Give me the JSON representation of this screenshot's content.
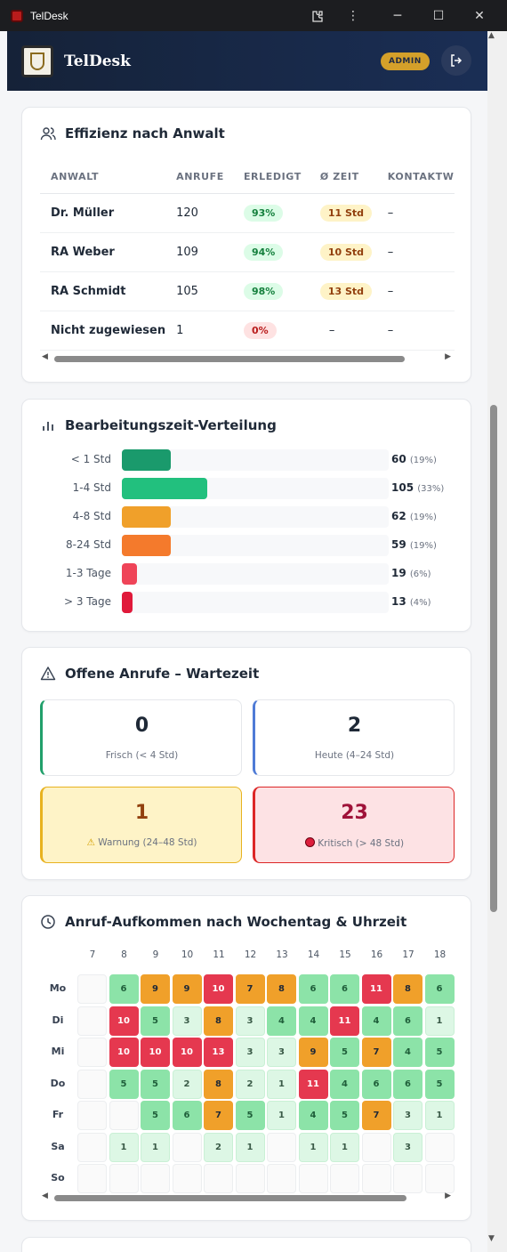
{
  "window": {
    "title": "TelDesk",
    "minimize": "─",
    "maximize": "☐",
    "close": "✕"
  },
  "header": {
    "brand": "TelDesk",
    "badge": "ADMIN"
  },
  "efficiency": {
    "title": "Effizienz nach Anwalt",
    "columns": [
      "ANWALT",
      "ANRUFE",
      "ERLEDIGT",
      "Ø ZEIT",
      "KONTAKTW"
    ],
    "rows": [
      {
        "name": "Dr. Müller",
        "calls": "120",
        "done": "93%",
        "done_status": "green",
        "time": "11 Std",
        "contact": "–"
      },
      {
        "name": "RA Weber",
        "calls": "109",
        "done": "94%",
        "done_status": "green",
        "time": "10 Std",
        "contact": "–"
      },
      {
        "name": "RA Schmidt",
        "calls": "105",
        "done": "98%",
        "done_status": "green",
        "time": "13 Std",
        "contact": "–"
      },
      {
        "name": "Nicht zugewiesen",
        "calls": "1",
        "done": "0%",
        "done_status": "red",
        "time": "–",
        "contact": "–"
      }
    ]
  },
  "distribution": {
    "title": "Bearbeitungszeit-Verteilung",
    "rows": [
      {
        "label": "< 1 Std",
        "value": "60",
        "pct": "(19%)",
        "fraction": 0.19,
        "color": "#1a9a6c"
      },
      {
        "label": "1-4 Std",
        "value": "105",
        "pct": "(33%)",
        "fraction": 0.33,
        "color": "#22c07e"
      },
      {
        "label": "4-8 Std",
        "value": "62",
        "pct": "(19%)",
        "fraction": 0.19,
        "color": "#f0a02a"
      },
      {
        "label": "8-24 Std",
        "value": "59",
        "pct": "(19%)",
        "fraction": 0.19,
        "color": "#f47a2c"
      },
      {
        "label": "1-3 Tage",
        "value": "19",
        "pct": "(6%)",
        "fraction": 0.06,
        "color": "#ef4458"
      },
      {
        "label": "> 3 Tage",
        "value": "13",
        "pct": "(4%)",
        "fraction": 0.04,
        "color": "#e0193a"
      }
    ]
  },
  "waiting": {
    "title": "Offene Anrufe – Wartezeit",
    "tiles": [
      {
        "value": "0",
        "label": "Frisch (< 4 Std)",
        "accent": "#21a06b",
        "bg": "#ffffff",
        "numcolor": "#1f2937"
      },
      {
        "value": "2",
        "label": "Heute (4–24 Std)",
        "accent": "#4f7bd6",
        "bg": "#ffffff",
        "numcolor": "#1f2937"
      },
      {
        "value": "1",
        "label": "Warnung (24–48 Std)",
        "icon": "warning-icon",
        "accent": "#e8b21f",
        "bg": "#fef3c7",
        "numcolor": "#92400e"
      },
      {
        "value": "23",
        "label": "Kritisch (> 48 Std)",
        "icon": "red-circle-icon",
        "accent": "#dc2626",
        "bg": "#fde2e4",
        "numcolor": "#9f1239"
      }
    ]
  },
  "heatmap": {
    "title": "Anruf-Aufkommen nach Wochentag & Uhrzeit",
    "hours": [
      "7",
      "8",
      "9",
      "10",
      "11",
      "12",
      "13",
      "14",
      "15",
      "16",
      "17",
      "18"
    ],
    "days": [
      "Mo",
      "Di",
      "Mi",
      "Do",
      "Fr",
      "Sa",
      "So"
    ],
    "values": [
      [
        null,
        6,
        9,
        9,
        10,
        7,
        8,
        6,
        6,
        11,
        8,
        6
      ],
      [
        null,
        10,
        5,
        3,
        8,
        3,
        4,
        4,
        11,
        4,
        6,
        1
      ],
      [
        null,
        10,
        10,
        10,
        13,
        3,
        3,
        9,
        5,
        7,
        4,
        5
      ],
      [
        null,
        5,
        5,
        2,
        8,
        2,
        1,
        11,
        4,
        6,
        6,
        5
      ],
      [
        null,
        null,
        5,
        6,
        7,
        5,
        1,
        4,
        5,
        7,
        3,
        1
      ],
      [
        null,
        1,
        1,
        null,
        2,
        1,
        null,
        1,
        1,
        null,
        3,
        null
      ],
      [
        null,
        null,
        null,
        null,
        null,
        null,
        null,
        null,
        null,
        null,
        null,
        null
      ]
    ]
  }
}
